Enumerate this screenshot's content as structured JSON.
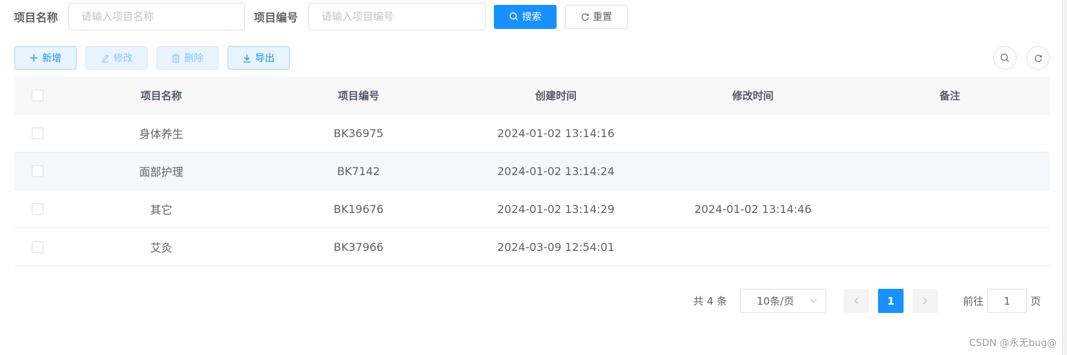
{
  "search": {
    "name_label": "项目名称",
    "name_placeholder": "请输入项目名称",
    "code_label": "项目编号",
    "code_placeholder": "请输入项目编号",
    "search_button": "搜索",
    "reset_button": "重置"
  },
  "toolbar": {
    "add": "新增",
    "edit": "修改",
    "delete": "删除",
    "export": "导出"
  },
  "table": {
    "headers": [
      "项目名称",
      "项目编号",
      "创建时间",
      "修改时间",
      "备注"
    ],
    "rows": [
      {
        "name": "身体养生",
        "code": "BK36975",
        "created": "2024-01-02 13:14:16",
        "modified": "",
        "remark": ""
      },
      {
        "name": "面部护理",
        "code": "BK7142",
        "created": "2024-01-02 13:14:24",
        "modified": "",
        "remark": ""
      },
      {
        "name": "其它",
        "code": "BK19676",
        "created": "2024-01-02 13:14:29",
        "modified": "2024-01-02 13:14:46",
        "remark": ""
      },
      {
        "name": "艾灸",
        "code": "BK37966",
        "created": "2024-03-09 12:54:01",
        "modified": "",
        "remark": ""
      }
    ]
  },
  "pagination": {
    "total_text": "共 4 条",
    "page_size": "10条/页",
    "current_page": "1",
    "goto_label": "前往",
    "goto_value": "1",
    "page_suffix": "页"
  },
  "watermark": "CSDN @永无bug@",
  "colors": {
    "primary": "#1890ff",
    "header_bg": "#f8f8f9",
    "stripe_bg": "#f5f7fa",
    "border": "#dcdfe6"
  }
}
